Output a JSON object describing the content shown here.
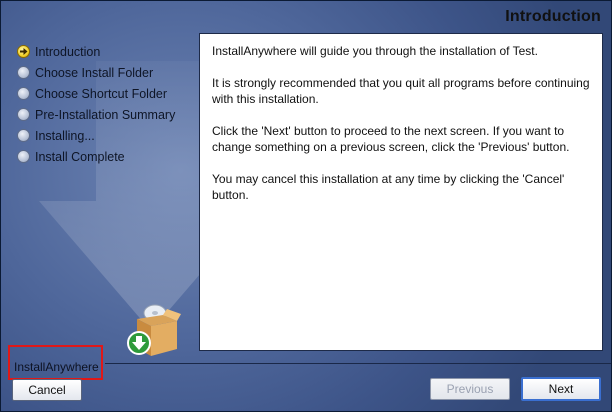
{
  "window": {
    "page_title": "Introduction"
  },
  "steps": [
    {
      "label": "Introduction",
      "state": "current"
    },
    {
      "label": "Choose Install Folder",
      "state": "pending"
    },
    {
      "label": "Choose Shortcut Folder",
      "state": "pending"
    },
    {
      "label": "Pre-Installation Summary",
      "state": "pending"
    },
    {
      "label": "Installing...",
      "state": "pending"
    },
    {
      "label": "Install Complete",
      "state": "pending"
    }
  ],
  "content": {
    "paragraphs": [
      "InstallAnywhere will guide you through the installation of Test.",
      "It is strongly recommended that you quit all programs before continuing with this installation.",
      "Click the 'Next' button to proceed to the next screen. If you want to change something on a previous screen, click the 'Previous' button.",
      "You may cancel this installation at any time by clicking the 'Cancel' button."
    ]
  },
  "footer": {
    "brand": "InstallAnywhere",
    "cancel_label": "Cancel",
    "previous_label": "Previous",
    "next_label": "Next"
  },
  "icons": {
    "step_current": "arrow-bullet-icon",
    "step_pending": "circle-bullet-icon",
    "installer": "install-box-icon"
  },
  "colors": {
    "background": "#4f679b",
    "highlight_border": "#e01818",
    "next_focus": "#3a6fd0",
    "current_step": "#f2d22a"
  }
}
